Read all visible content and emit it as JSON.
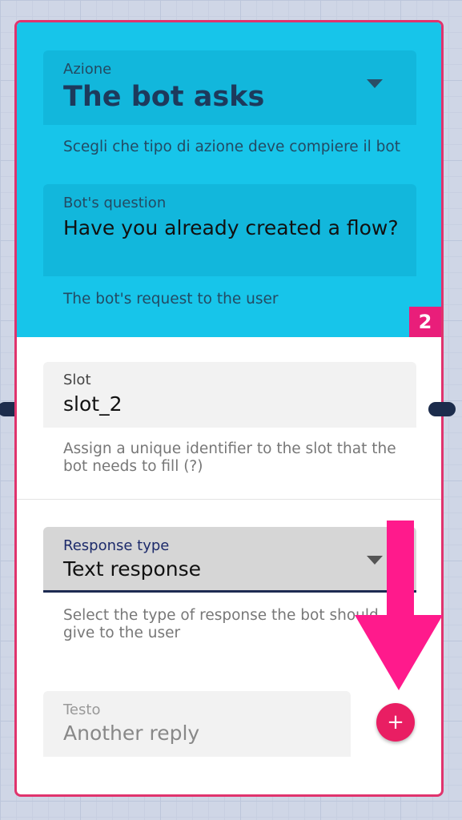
{
  "action_field": {
    "label": "Azione",
    "value": "The bot asks",
    "help": "Scegli che tipo di azione deve compiere il bot"
  },
  "question_field": {
    "label": "Bot's question",
    "value": "Have you already created a flow?",
    "help": "The bot's request to the user"
  },
  "step_badge": "2",
  "slot_field": {
    "label": "Slot",
    "value": "slot_2",
    "help": "Assign a unique identifier to the slot that the bot needs to fill (?)"
  },
  "response_type_field": {
    "label": "Response type",
    "value": "Text response",
    "help": "Select the type of response the bot should give to the user"
  },
  "text_field": {
    "label": "Testo",
    "placeholder": "Another reply"
  },
  "add_button": {
    "label": "+",
    "icon": "plus-icon"
  },
  "colors": {
    "card_border": "#e0336d",
    "header_bg": "#17c5ea",
    "badge_bg": "#e91e7a",
    "add_button_bg": "#e91e63",
    "arrow": "#ff1a8c",
    "connector": "#1c2c4c"
  }
}
